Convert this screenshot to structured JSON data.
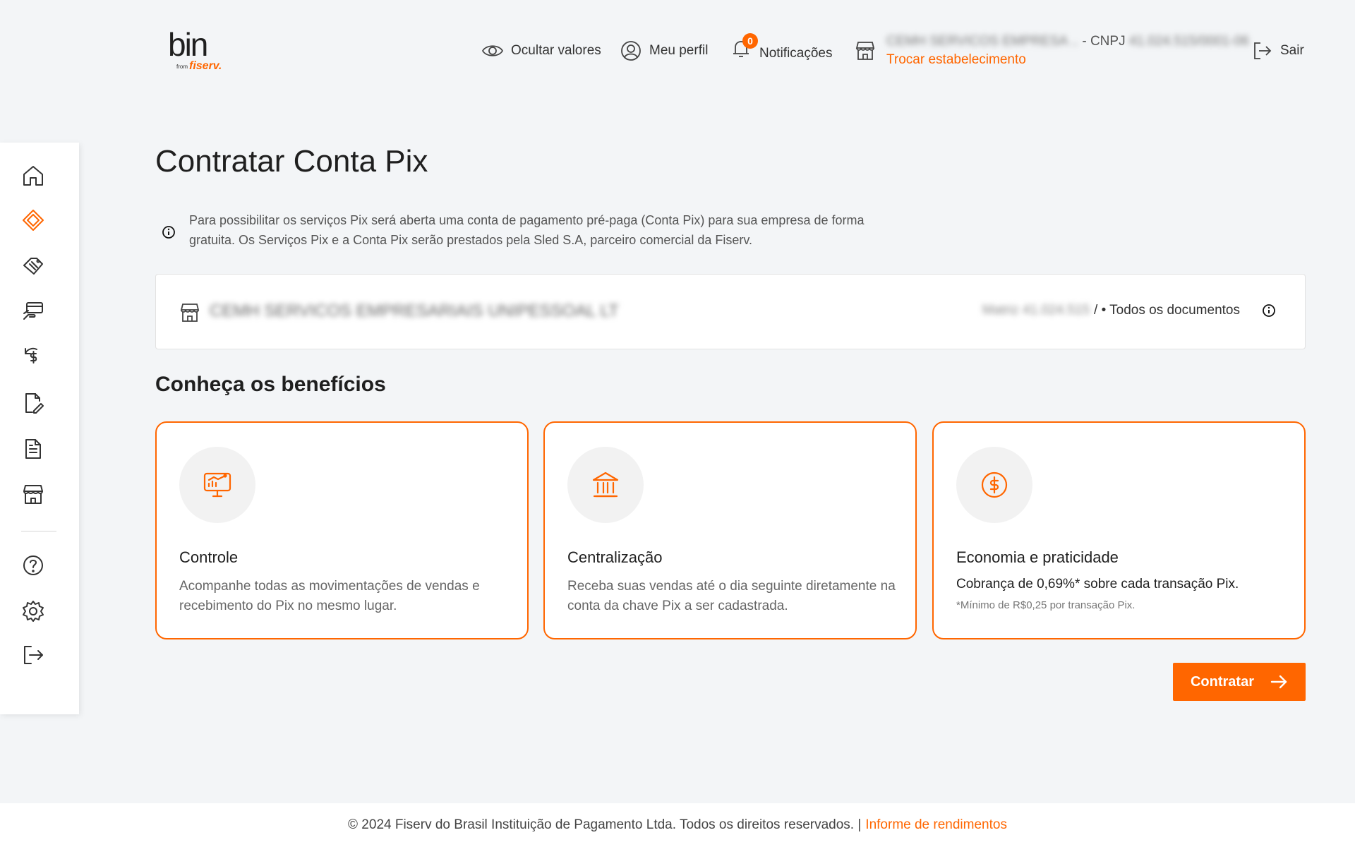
{
  "brand": {
    "name": "bin",
    "from": "from",
    "parent": "fiserv."
  },
  "header": {
    "hide_values": "Ocultar valores",
    "profile": "Meu perfil",
    "notifications": {
      "label": "Notificações",
      "count": "0"
    },
    "establishment": {
      "name": "CEMH SERVICOS EMPRESA ..",
      "cnpj_label": " - CNPJ ",
      "cnpj_value": "41.024.515/0001-06",
      "switch_label": "Trocar estabelecimento"
    },
    "logout": "Sair"
  },
  "sidebar": {
    "items": [
      "home-icon",
      "pix-icon",
      "handshake-icon",
      "card-payment-icon",
      "cashback-icon",
      "edit-document-icon",
      "document-icon",
      "store-icon",
      "help-icon",
      "settings-icon",
      "logout-icon"
    ],
    "active": "pix-icon"
  },
  "main": {
    "title": "Contratar Conta Pix",
    "info": "Para possibilitar os serviços Pix será aberta uma conta de pagamento pré-paga (Conta Pix) para sua empresa de forma gratuita. Os Serviços Pix e a Conta Pix serão prestados pela Sled S.A, parceiro comercial da Fiserv.",
    "company": {
      "name": "CEMH SERVICOS EMPRESARIAIS UNIPESSOAL LT",
      "doc_id": "Matriz 41.024.515",
      "docs_label": "/ • Todos os documentos"
    },
    "benefits_title": "Conheça os benefícios",
    "benefits": [
      {
        "title": "Controle",
        "desc": "Acompanhe todas as movimentações de vendas e recebimento do Pix no mesmo lugar."
      },
      {
        "title": "Centralização",
        "desc": "Receba suas vendas até o dia seguinte diretamente na conta da chave Pix a ser cadastrada."
      },
      {
        "title": "Economia e praticidade",
        "desc": "Cobrança de 0,69%* sobre cada transação Pix.",
        "footnote": "*Mínimo de R$0,25 por transação Pix."
      }
    ],
    "cta": "Contratar"
  },
  "footer": {
    "copyright": "© 2024 Fiserv do Brasil Instituição de Pagamento Ltda. Todos os direitos reservados. |",
    "link": "Informe de rendimentos"
  },
  "colors": {
    "accent": "#ff6600",
    "background": "#f3f5f7"
  }
}
